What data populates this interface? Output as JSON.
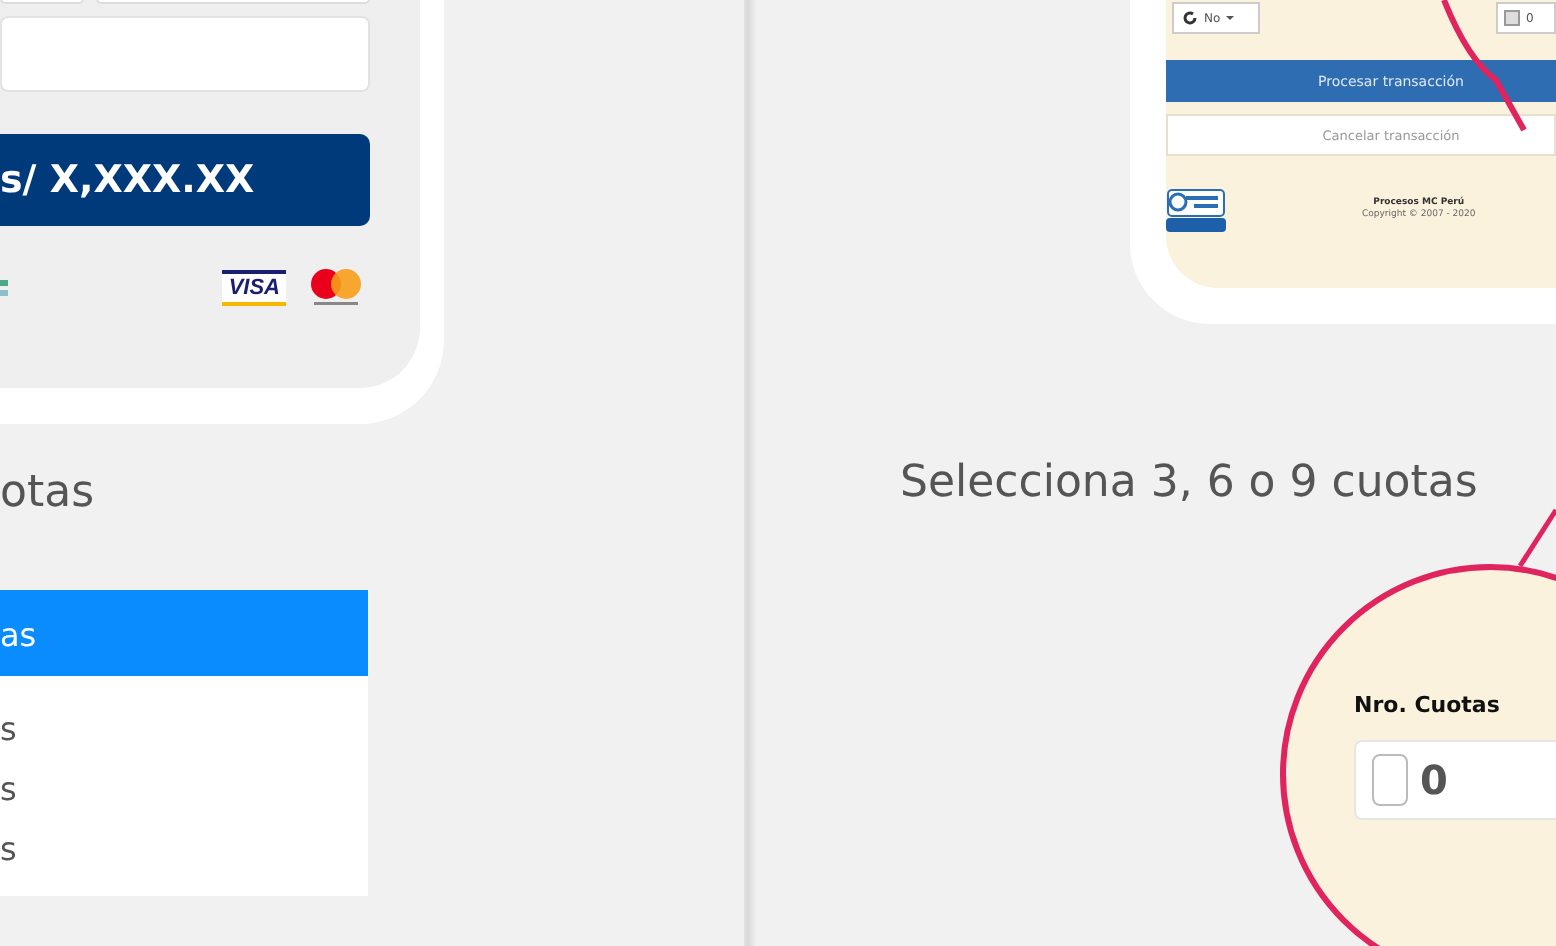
{
  "left_mockup": {
    "amount_button": "s/ X,XXX.XX",
    "visa_logo": "VISA"
  },
  "left_heading": "otas",
  "cuotas_list": [
    {
      "label": "as",
      "selected": true
    },
    {
      "label": "s",
      "selected": false
    },
    {
      "label": "s",
      "selected": false
    },
    {
      "label": "s",
      "selected": false
    }
  ],
  "right_mockup": {
    "dropdown": "No",
    "quantity": "0",
    "process_button": "Procesar transacción",
    "cancel_button": "Cancelar transacción",
    "footer": [
      "Procesos MC Perú",
      "Copyright © 2007 - 2020"
    ]
  },
  "right_heading": "Selecciona 3, 6 o 9 cuotas",
  "magnifier": {
    "label": "Nro. Cuotas",
    "value": "0"
  }
}
